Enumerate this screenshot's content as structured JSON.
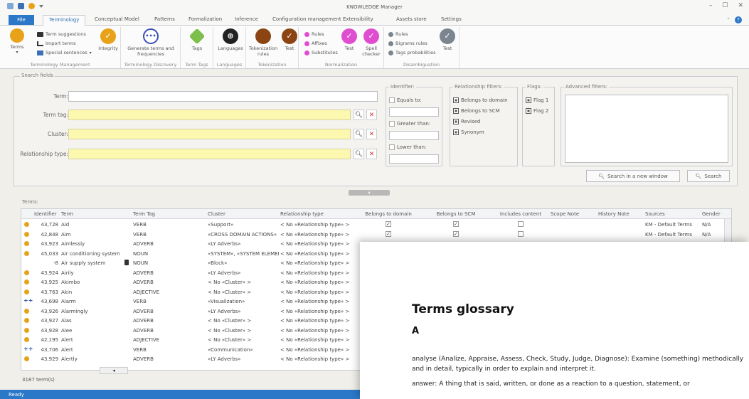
{
  "app": {
    "title": "KNOWLEDGE Manager",
    "window_controls": [
      "–",
      "☐",
      "✕"
    ]
  },
  "tabs": [
    {
      "label": "File",
      "active": false,
      "kind": "file"
    },
    {
      "label": "Terminology",
      "active": true
    },
    {
      "label": "Conceptual Model"
    },
    {
      "label": "Patterns"
    },
    {
      "label": "Formalization"
    },
    {
      "label": "Inference"
    },
    {
      "label": "Configuration management"
    },
    {
      "label": "Extensibility"
    },
    {
      "label": "Assets store"
    },
    {
      "label": "Settings"
    }
  ],
  "ribbon": {
    "terms_label": "Terms",
    "term_suggestions": "Term suggestions",
    "import_terms": "Import terms",
    "special_sentences": "Special sentences",
    "integrity": "Integrity",
    "generate_terms": "Generate terms and frequencies",
    "tags": "Tags",
    "languages": "Languages",
    "tokenization_rules": "Tokenization rules",
    "test": "Test",
    "rules": "Rules",
    "affixes": "Affixes",
    "substitutes": "Substitutes",
    "test2": "Test",
    "spell_checker": "Spell checker",
    "d_rules": "Rules",
    "bigrams_rules": "Bigrams rules",
    "tags_probabilities": "Tags probabilities",
    "test3": "Test",
    "groups": {
      "terminology_management": "Terminology Management",
      "terminology_discovery": "Terminology Discovery",
      "term_tags": "Term Tags",
      "languages": "Languages",
      "tokenization": "Tokenization",
      "normalization": "Normalization",
      "disambiguation": "Disambiguation"
    }
  },
  "search": {
    "legend": "Search fields",
    "term_label": "Term:",
    "term_tag_label": "Term tag:",
    "cluster_label": "Cluster:",
    "relationship_type_label": "Relationship type:",
    "identifier": {
      "legend": "Identifier:",
      "equals_to": "Equals to:",
      "greater_than": "Greater than:",
      "lower_than": "Lower than:"
    },
    "relationship_filters": {
      "legend": "Relationship filters:",
      "items": [
        "Belongs to domain",
        "Belongs to SCM",
        "Revised",
        "Synonym"
      ]
    },
    "flags": {
      "legend": "Flags:",
      "items": [
        "Flag 1",
        "Flag 2"
      ]
    },
    "advanced_filters": "Advanced filters:",
    "search_new_window": "Search in a new window",
    "search_button": "Search"
  },
  "terms": {
    "legend": "Terms:",
    "columns": [
      "Identifier",
      "Term",
      "Term Tag",
      "Cluster",
      "Relationship type",
      "Belongs to domain",
      "Belongs to SCM",
      "Includes content",
      "Scope Note",
      "History Note",
      "Sources",
      "Gender"
    ],
    "rows": [
      {
        "marker": "dot",
        "id": "43,728",
        "term": "Aid",
        "tag": "VERB",
        "cluster": "«Support»",
        "rel": "< No «Relationship type» >",
        "domain": true,
        "scm": true,
        "content": false,
        "sources": "KM - Default Terms",
        "gender": "N/A"
      },
      {
        "marker": "dot",
        "id": "42,848",
        "term": "Aim",
        "tag": "VERB",
        "cluster": "«CROSS DOMAIN ACTIONS»",
        "rel": "< No «Relationship type» >",
        "domain": true,
        "scm": true,
        "content": false,
        "sources": "KM - Default Terms",
        "gender": "N/A"
      },
      {
        "marker": "dot",
        "id": "43,923",
        "term": "Aimlessly",
        "tag": "ADVERB",
        "cluster": "«LY Adverbs»",
        "rel": "< No «Relationship type» >"
      },
      {
        "marker": "dot",
        "id": "45,033",
        "term": "Air conditioning system",
        "tag": "NOUN",
        "cluster": "«SYSTEM», «SYSTEM ELEMENT»",
        "rel": "< No «Relationship type» >"
      },
      {
        "marker": "none",
        "id": "-8",
        "term": "Air supply system",
        "tag": "NOUN",
        "cluster": "«Block»",
        "rel": "< No «Relationship type» >"
      },
      {
        "marker": "dot",
        "id": "43,924",
        "term": "Airily",
        "tag": "ADVERB",
        "cluster": "«LY Adverbs»",
        "rel": "< No «Relationship type» >"
      },
      {
        "marker": "dot",
        "id": "43,925",
        "term": "Akimbo",
        "tag": "ADVERB",
        "cluster": "< No «Cluster» >",
        "rel": "< No «Relationship type» >"
      },
      {
        "marker": "dot",
        "id": "43,763",
        "term": "Akin",
        "tag": "ADJECTIVE",
        "cluster": "< No «Cluster» >",
        "rel": "< No «Relationship type» >"
      },
      {
        "marker": "plus",
        "id": "43,698",
        "term": "Alarm",
        "tag": "VERB",
        "cluster": "«Visualization»",
        "rel": "< No «Relationship type» >"
      },
      {
        "marker": "dot",
        "id": "43,926",
        "term": "Alarmingly",
        "tag": "ADVERB",
        "cluster": "«LY Adverbs»",
        "rel": "< No «Relationship type» >"
      },
      {
        "marker": "dot",
        "id": "43,927",
        "term": "Alas",
        "tag": "ADVERB",
        "cluster": "< No «Cluster» >",
        "rel": "< No «Relationship type» >"
      },
      {
        "marker": "dot",
        "id": "43,928",
        "term": "Alee",
        "tag": "ADVERB",
        "cluster": "< No «Cluster» >",
        "rel": "< No «Relationship type» >"
      },
      {
        "marker": "dot",
        "id": "42,195",
        "term": "Alert",
        "tag": "ADJECTIVE",
        "cluster": "< No «Cluster» >",
        "rel": "< No «Relationship type» >"
      },
      {
        "marker": "plus",
        "id": "43,706",
        "term": "Alert",
        "tag": "VERB",
        "cluster": "«Communication»",
        "rel": "< No «Relationship type» >"
      },
      {
        "marker": "dot",
        "id": "43,929",
        "term": "Alertly",
        "tag": "ADVERB",
        "cluster": "«LY Adverbs»",
        "rel": "< No «Relationship type» >"
      }
    ],
    "count": "3187 term(s)"
  },
  "status": "Ready",
  "glossary": {
    "title": "Terms glossary",
    "letter": "A",
    "entries": [
      "analyse (Analize, Appraise, Assess, Check, Study, Judge, Diagnose): Examine (something) methodically and in detail, typically in order to explain and interpret it.",
      "answer: A thing that is said, written, or done as a reaction to a question, statement, or"
    ]
  },
  "colors": {
    "accent": "#2b78c8",
    "terms_dot": "#e8a21a",
    "highlight_yellow": "#fcf8b0",
    "magenta": "#e04ed0",
    "brown": "#8b4513"
  }
}
